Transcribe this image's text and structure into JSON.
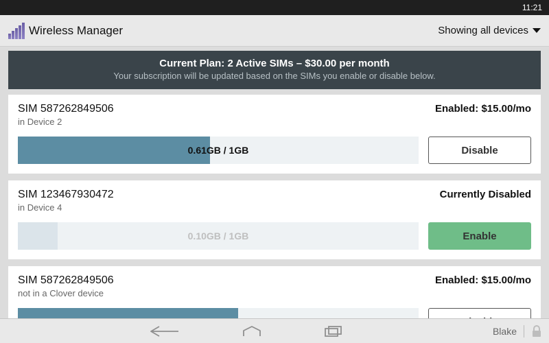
{
  "status_bar": {
    "time": "11:21"
  },
  "header": {
    "app_title": "Wireless Manager",
    "showing_label": "Showing all devices"
  },
  "plan_banner": {
    "title": "Current Plan: 2 Active SIMs – $30.00 per month",
    "subtitle": "Your subscription will be updated based on the SIMs you enable or disable below."
  },
  "sims": [
    {
      "name": "SIM 587262849506",
      "location": "in Device 2",
      "status": "Enabled: $15.00/mo",
      "usage_label": "0.61GB / 1GB",
      "usage_pct": 48,
      "action_label": "Disable",
      "action_style": "outline",
      "disabled_bar": false
    },
    {
      "name": "SIM 123467930472",
      "location": "in Device 4",
      "status": "Currently Disabled",
      "usage_label": "0.10GB / 1GB",
      "usage_pct": 10,
      "action_label": "Enable",
      "action_style": "enable",
      "disabled_bar": true
    },
    {
      "name": "SIM 587262849506",
      "location": "not in a Clover device",
      "status": "Enabled: $15.00/mo",
      "usage_label": "",
      "usage_pct": 55,
      "action_label": "Disable",
      "action_style": "outline",
      "disabled_bar": false
    }
  ],
  "navbar": {
    "user": "Blake"
  }
}
